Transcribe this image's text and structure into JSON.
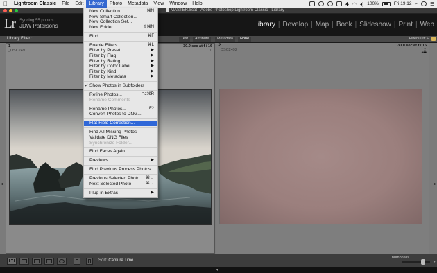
{
  "menubar": {
    "app": "Lightroom Classic",
    "items": [
      "File",
      "Edit",
      "Library",
      "Photo",
      "Metadata",
      "View",
      "Window",
      "Help"
    ],
    "active": "Library",
    "battery": "100%",
    "clock": "Fri 19:12",
    "status_icons": [
      "dropbox-icon",
      "cloud-icon",
      "sync-icon",
      "airplay-icon",
      "bluetooth-icon",
      "wifi-icon",
      "volume-icon",
      "search-icon",
      "siri-icon",
      "list-icon"
    ]
  },
  "window": {
    "title": "MASTER.lrcat - Adobe Photoshop Lightroom Classic - Library",
    "lights": [
      "#ff5f56",
      "#ffbd2e",
      "#27c93f"
    ]
  },
  "identity": {
    "logo": "Lr",
    "status": "Syncing 55 photos",
    "name": "JDW Patersons"
  },
  "modules": [
    "Library",
    "Develop",
    "Map",
    "Book",
    "Slideshow",
    "Print",
    "Web"
  ],
  "active_module": "Library",
  "filterbar": {
    "label": "Library Filter :",
    "chips": [
      "Text",
      "Attribute",
      "Metadata",
      "None"
    ],
    "active_chip": "None",
    "filters": "Filters Off ÷"
  },
  "grid": {
    "cells": [
      {
        "index": "1",
        "filename": "_DSC2491",
        "exif": "30.0 sec at f / 16",
        "num": "1",
        "dots": ""
      },
      {
        "index": "2",
        "filename": "_DSC2492",
        "exif": "30.0 sec at f / 16",
        "num": "2",
        "dots": "•••"
      }
    ]
  },
  "toolbar": {
    "sort_label": "Sort:",
    "sort_value": "Capture Time",
    "thumbnails_label": "Thumbnails",
    "thumb_size": 0.78
  },
  "dropdown": {
    "items": [
      {
        "label": "New Collection...",
        "shortcut": "⌘N"
      },
      {
        "label": "New Smart Collection...",
        "shortcut": ""
      },
      {
        "label": "New Collection Set...",
        "shortcut": ""
      },
      {
        "label": "New Folder...",
        "shortcut": "⇧⌘N"
      },
      {
        "sep": true
      },
      {
        "label": "Find...",
        "shortcut": "⌘F"
      },
      {
        "sep": true
      },
      {
        "label": "Enable Filters",
        "shortcut": "⌘L"
      },
      {
        "label": "Filter by Preset",
        "submenu": true
      },
      {
        "label": "Filter by Flag",
        "submenu": true
      },
      {
        "label": "Filter by Rating",
        "submenu": true
      },
      {
        "label": "Filter by Color Label",
        "submenu": true
      },
      {
        "label": "Filter by Kind",
        "submenu": true
      },
      {
        "label": "Filter by Metadata",
        "submenu": true
      },
      {
        "sep": true
      },
      {
        "label": "Show Photos in Subfolders",
        "checked": true
      },
      {
        "sep": true
      },
      {
        "label": "Refine Photos...",
        "shortcut": "⌥⌘R"
      },
      {
        "label": "Rename Comments",
        "disabled": true
      },
      {
        "sep": true
      },
      {
        "label": "Rename Photos...",
        "shortcut": "F2"
      },
      {
        "label": "Convert Photos to DNG...",
        "shortcut": ""
      },
      {
        "sep": true
      },
      {
        "label": "Flat-Field Correction...",
        "selected": true
      },
      {
        "sep": true
      },
      {
        "label": "Find All Missing Photos",
        "shortcut": ""
      },
      {
        "label": "Validate DNG Files",
        "shortcut": ""
      },
      {
        "label": "Synchronize Folder...",
        "disabled": true
      },
      {
        "sep": true
      },
      {
        "label": "Find Faces Again...",
        "shortcut": ""
      },
      {
        "sep": true
      },
      {
        "label": "Previews",
        "submenu": true
      },
      {
        "sep": true
      },
      {
        "label": "Find Previous Process Photos",
        "shortcut": ""
      },
      {
        "sep": true
      },
      {
        "label": "Previous Selected Photo",
        "shortcut": "⌘←"
      },
      {
        "label": "Next Selected Photo",
        "shortcut": "⌘→"
      },
      {
        "sep": true
      },
      {
        "label": "Plug-in Extras",
        "submenu": true
      }
    ]
  }
}
